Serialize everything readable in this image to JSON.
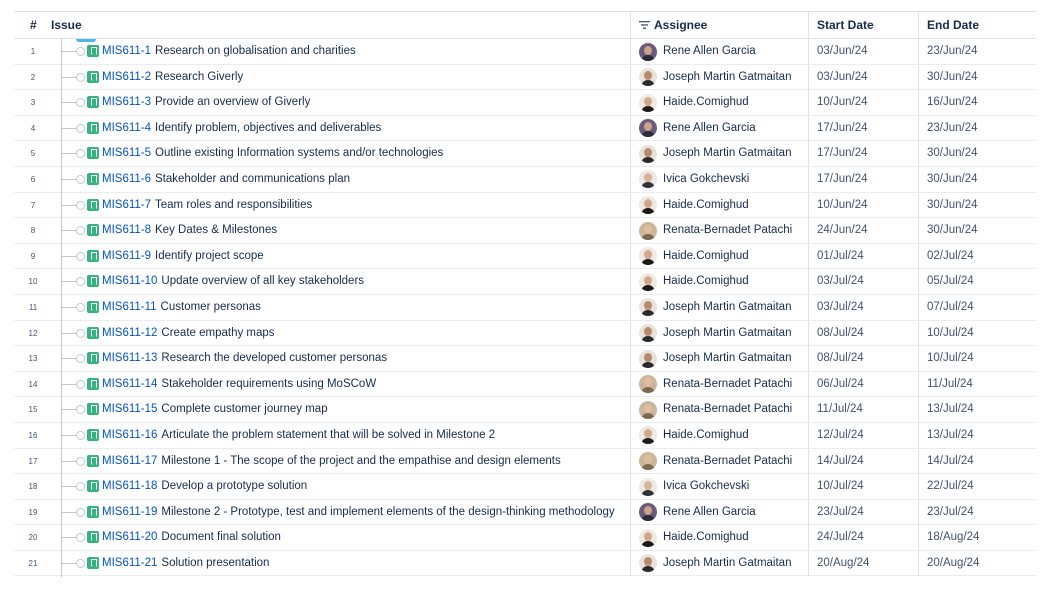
{
  "header": {
    "num": "#",
    "issue": "Issue",
    "assignee": "Assignee",
    "start": "Start Date",
    "end": "End Date"
  },
  "rows": [
    {
      "n": "1",
      "key": "MIS611-1",
      "title": "Research on globalisation and charities",
      "assignee": "Rene Allen Garcia",
      "start": "03/Jun/24",
      "end": "23/Jun/24"
    },
    {
      "n": "2",
      "key": "MIS611-2",
      "title": "Research Giverly",
      "assignee": "Joseph Martin Gatmaitan",
      "start": "03/Jun/24",
      "end": "30/Jun/24"
    },
    {
      "n": "3",
      "key": "MIS611-3",
      "title": "Provide an overview of Giverly",
      "assignee": "Haide.Comighud",
      "start": "10/Jun/24",
      "end": "16/Jun/24"
    },
    {
      "n": "4",
      "key": "MIS611-4",
      "title": "Identify problem, objectives and deliverables",
      "assignee": "Rene Allen Garcia",
      "start": "17/Jun/24",
      "end": "23/Jun/24"
    },
    {
      "n": "5",
      "key": "MIS611-5",
      "title": "Outline existing Information systems and/or technologies",
      "assignee": "Joseph Martin Gatmaitan",
      "start": "17/Jun/24",
      "end": "30/Jun/24"
    },
    {
      "n": "6",
      "key": "MIS611-6",
      "title": "Stakeholder and communications plan",
      "assignee": "Ivica Gokchevski",
      "start": "17/Jun/24",
      "end": "30/Jun/24"
    },
    {
      "n": "7",
      "key": "MIS611-7",
      "title": "Team roles and responsibilities",
      "assignee": "Haide.Comighud",
      "start": "10/Jun/24",
      "end": "30/Jun/24"
    },
    {
      "n": "8",
      "key": "MIS611-8",
      "title": "Key Dates & Milestones",
      "assignee": "Renata-Bernadet Patachi",
      "start": "24/Jun/24",
      "end": "30/Jun/24"
    },
    {
      "n": "9",
      "key": "MIS611-9",
      "title": "Identify project scope",
      "assignee": "Haide.Comighud",
      "start": "01/Jul/24",
      "end": "02/Jul/24"
    },
    {
      "n": "10",
      "key": "MIS611-10",
      "title": "Update overview of all key stakeholders",
      "assignee": "Haide.Comighud",
      "start": "03/Jul/24",
      "end": "05/Jul/24"
    },
    {
      "n": "11",
      "key": "MIS611-11",
      "title": "Customer personas",
      "assignee": "Joseph Martin Gatmaitan",
      "start": "03/Jul/24",
      "end": "07/Jul/24"
    },
    {
      "n": "12",
      "key": "MIS611-12",
      "title": "Create empathy maps",
      "assignee": "Joseph Martin Gatmaitan",
      "start": "08/Jul/24",
      "end": "10/Jul/24"
    },
    {
      "n": "13",
      "key": "MIS611-13",
      "title": "Research the developed customer personas",
      "assignee": "Joseph Martin Gatmaitan",
      "start": "08/Jul/24",
      "end": "10/Jul/24"
    },
    {
      "n": "14",
      "key": "MIS611-14",
      "title": "Stakeholder requirements using MoSCoW",
      "assignee": "Renata-Bernadet Patachi",
      "start": "06/Jul/24",
      "end": "11/Jul/24"
    },
    {
      "n": "15",
      "key": "MIS611-15",
      "title": "Complete customer journey map",
      "assignee": "Renata-Bernadet Patachi",
      "start": "11/Jul/24",
      "end": "13/Jul/24"
    },
    {
      "n": "16",
      "key": "MIS611-16",
      "title": "Articulate the problem statement that will be solved in Milestone 2",
      "assignee": "Haide.Comighud",
      "start": "12/Jul/24",
      "end": "13/Jul/24"
    },
    {
      "n": "17",
      "key": "MIS611-17",
      "title": "Milestone 1 - The scope of the project and the empathise and design elements",
      "assignee": "Renata-Bernadet Patachi",
      "start": "14/Jul/24",
      "end": "14/Jul/24"
    },
    {
      "n": "18",
      "key": "MIS611-18",
      "title": "Develop a prototype solution",
      "assignee": "Ivica Gokchevski",
      "start": "10/Jul/24",
      "end": "22/Jul/24"
    },
    {
      "n": "19",
      "key": "MIS611-19",
      "title": "Milestone 2 - Prototype, test and implement elements of the design-thinking methodology",
      "assignee": "Rene Allen Garcia",
      "start": "23/Jul/24",
      "end": "23/Jul/24"
    },
    {
      "n": "20",
      "key": "MIS611-20",
      "title": "Document final solution",
      "assignee": "Haide.Comighud",
      "start": "24/Jul/24",
      "end": "18/Aug/24"
    },
    {
      "n": "21",
      "key": "MIS611-21",
      "title": "Solution presentation",
      "assignee": "Joseph Martin Gatmaitan",
      "start": "20/Aug/24",
      "end": "20/Aug/24"
    }
  ],
  "avatars": {
    "Rene Allen Garcia": {
      "bg": "#6b5b7a",
      "face": "#c9a48a",
      "body": "#2b2b3a"
    },
    "Joseph Martin Gatmaitan": {
      "bg": "#e8e2dc",
      "face": "#b98a6c",
      "body": "#2a2a2a"
    },
    "Haide.Comighud": {
      "bg": "#efe9e4",
      "face": "#d2a88d",
      "body": "#1d1a1a"
    },
    "Ivica Gokchevski": {
      "bg": "#ece8e4",
      "face": "#d9b49b",
      "body": "#2f3136"
    },
    "Renata-Bernadet Patachi": {
      "bg": "#c8b79a",
      "face": "#e1bc9c",
      "body": "#7c6a4e"
    }
  }
}
